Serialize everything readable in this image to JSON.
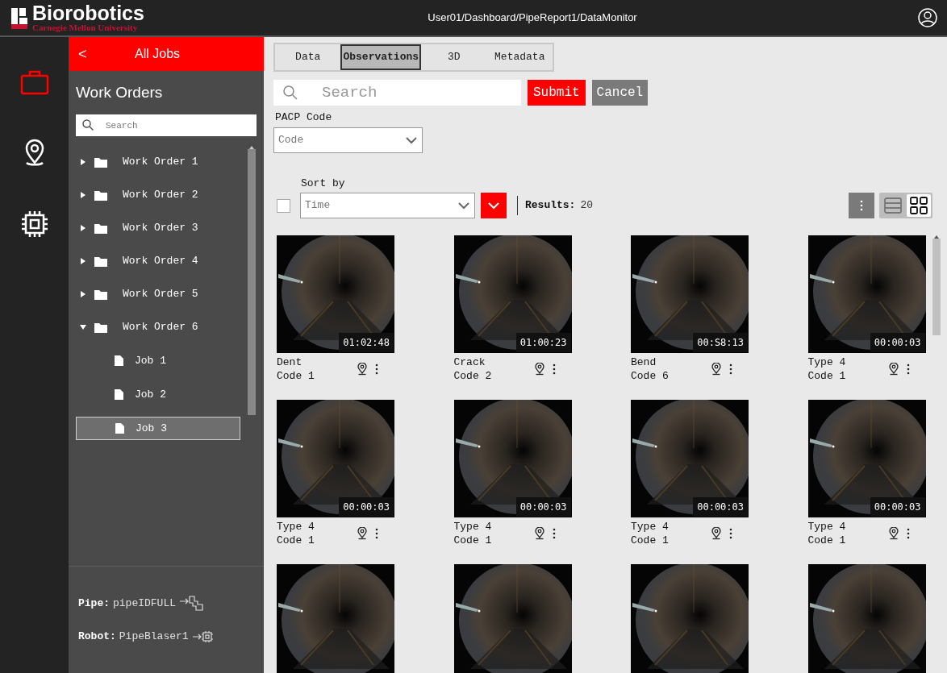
{
  "header": {
    "brand": "Biorobotics",
    "university": "Carnegie Mellon University",
    "breadcrumb": "User01/Dashboard/PipeReport1/DataMonitor"
  },
  "rail": [
    {
      "kind": "briefcase",
      "selected": true
    },
    {
      "kind": "pin",
      "selected": false
    },
    {
      "kind": "chip",
      "selected": false
    }
  ],
  "sidebar": {
    "back": "<",
    "title": "All Jobs",
    "heading": "Work Orders",
    "search_placeholder": "Search",
    "tree": [
      {
        "label": "Work Order 1",
        "expanded": false
      },
      {
        "label": "Work Order 2",
        "expanded": false
      },
      {
        "label": "Work Order 3",
        "expanded": false
      },
      {
        "label": "Work Order 4",
        "expanded": false
      },
      {
        "label": "Work Order 5",
        "expanded": false
      },
      {
        "label": "Work Order 6",
        "expanded": true,
        "children": [
          {
            "label": "Job 1",
            "selected": false
          },
          {
            "label": "Job 2",
            "selected": false
          },
          {
            "label": "Job 3",
            "selected": true
          }
        ]
      }
    ],
    "info": [
      {
        "label": "Pipe:",
        "value": "pipeIDFULL",
        "kind": "pipe"
      },
      {
        "label": "Robot:",
        "value": "PipeBlaser1",
        "kind": "robot"
      }
    ]
  },
  "tabs": [
    {
      "label": "Data",
      "selected": false
    },
    {
      "label": "Observations",
      "selected": true
    },
    {
      "label": "3D",
      "selected": false
    },
    {
      "label": "Metadata",
      "selected": false
    }
  ],
  "search": {
    "placeholder": "Search",
    "submit": "Submit",
    "cancel": "Cancel"
  },
  "pacp": {
    "label": "PACP Code",
    "placeholder": "Code"
  },
  "sort": {
    "label": "Sort by",
    "value": "Time",
    "select_all_checked": false,
    "results_label": "Results:",
    "results": "20"
  },
  "view": [
    {
      "kind": "list",
      "selected": false
    },
    {
      "kind": "grid",
      "selected": true
    }
  ],
  "cards": [
    {
      "time": "01:02:48",
      "name": "Dent",
      "code": "Code 1"
    },
    {
      "time": "01:00:23",
      "name": "Crack",
      "code": "Code 2"
    },
    {
      "time": "00:S8:13",
      "name": "Bend",
      "code": "Code 6"
    },
    {
      "time": "00:00:03",
      "name": "Type 4",
      "code": "Code 1"
    },
    {
      "time": "00:00:03",
      "name": "Type 4",
      "code": "Code 1"
    },
    {
      "time": "00:00:03",
      "name": "Type 4",
      "code": "Code 1"
    },
    {
      "time": "00:00:03",
      "name": "Type 4",
      "code": "Code 1"
    },
    {
      "time": "00:00:03",
      "name": "Type 4",
      "code": "Code 1"
    },
    {
      "kind": "picture"
    },
    {
      "kind": "picture"
    },
    {
      "kind": "picture"
    },
    {
      "kind": "picture"
    }
  ]
}
